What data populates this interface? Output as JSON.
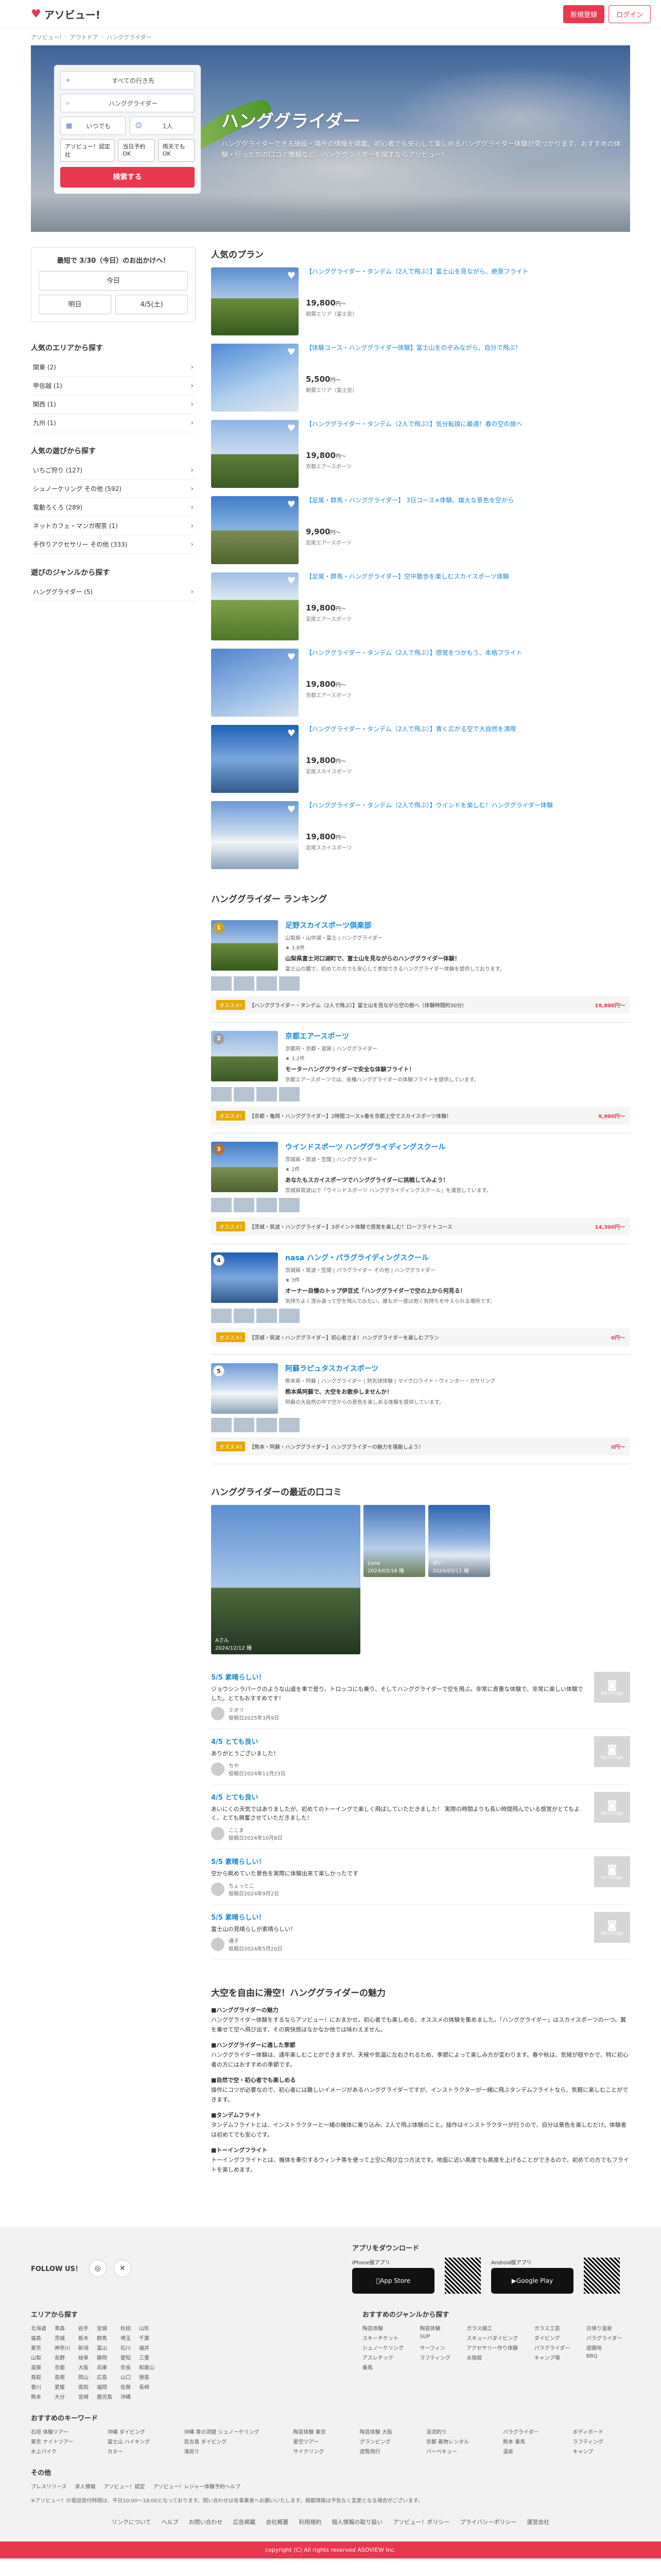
{
  "header": {
    "logo": "アソビュー!",
    "signup": "新規登録",
    "login": "ログイン"
  },
  "breadcrumb": [
    "アソビュー!",
    "アウトドア",
    "ハンググライダー"
  ],
  "search": {
    "area": "すべての行き先",
    "keyword": "ハンググライダー",
    "date": "いつでも",
    "people": "1人",
    "chip1": "アソビュー！認定社",
    "chip2": "当日予約OK",
    "chip3": "雨天でもOK",
    "button": "検索する"
  },
  "hero": {
    "title": "ハンググライダー",
    "desc": "ハンググライダーできる施設・場所の情報を掲載。初心者でも安心して楽しめるハンググライダー体験が見つかります。おすすめの体験・行った方の口コミ情報など、ハンググライダーを探すならアソビュー！"
  },
  "date_box": {
    "title": "最短で 3/30（今日）のお出かけへ！",
    "today": "今日",
    "tomorrow": "明日",
    "after": "4/5(土)"
  },
  "area_section": {
    "title": "人気のエリアから探す",
    "items": [
      "関東 (2)",
      "甲信越 (1)",
      "関西 (1)",
      "九州 (1)"
    ]
  },
  "play_section": {
    "title": "人気の遊びから探す",
    "items": [
      "いちご狩り (127)",
      "シュノーケリング その他 (592)",
      "電動ろくろ (289)",
      "ネットカフェ・マンガ喫茶 (1)",
      "手作りアクセサリー その他 (333)"
    ]
  },
  "genre_section": {
    "title": "遊びのジャンルから探す",
    "items": [
      "ハンググライダー (5)"
    ]
  },
  "plans_title": "人気のプラン",
  "plans": [
    {
      "title": "【ハンググライダー・タンデム（2人で飛ぶ）】富士山を見ながら、絶景フライト",
      "price": "19,800",
      "unit": "円〜",
      "shop": "朝霧エリア（富士宮）",
      "img": "img-a"
    },
    {
      "title": "【体験コース・ハンググライダー体験】富士山をのぞみながら、自分で飛ぶ！",
      "price": "5,500",
      "unit": "円〜",
      "shop": "朝霧エリア（富士宮）",
      "img": "img-b"
    },
    {
      "title": "【ハンググライダー・タンデム（2人で飛ぶ）】気分転換に最適！春の空の旅へ",
      "price": "19,800",
      "unit": "円〜",
      "shop": "京都エアースポーツ",
      "img": "img-c"
    },
    {
      "title": "【足尾・群馬・ハンググライダー】 3日コース×体験、雄大な景色を空から",
      "price": "9,900",
      "unit": "円〜",
      "shop": "足尾エアースポーツ",
      "img": "img-d"
    },
    {
      "title": "【足尾・群馬・ハンググライダー】空中散歩を楽しむスカイスポーツ体験",
      "price": "19,800",
      "unit": "円〜",
      "shop": "足尾エアースポーツ",
      "img": "img-e"
    },
    {
      "title": "【ハンググライダー・タンデム（2人で飛ぶ）】感覚をつかもう、本格フライト",
      "price": "19,800",
      "unit": "円〜",
      "shop": "京都エアースポーツ",
      "img": "img-f"
    },
    {
      "title": "【ハンググライダー・タンデム（2人で飛ぶ）】青く広がる空で大自然を満喫",
      "price": "19,800",
      "unit": "円〜",
      "shop": "足尾スカイスポーツ",
      "img": "img-g"
    },
    {
      "title": "【ハンググライダー・タンデム（2人で飛ぶ）】ウインドを楽しむ！ハンググライダー体験",
      "price": "19,800",
      "unit": "円〜",
      "shop": "足尾スカイスポーツ",
      "img": "img-h"
    }
  ],
  "ranking_title": "ハンググライダー ランキング",
  "ranking": [
    {
      "rank": "1",
      "name": "足野スカイスポーツ倶楽部",
      "meta": "山梨県・山中湖・富士 | ハンググライダー",
      "rating": "★ 3.8件",
      "lead": "山梨県富士河口湖町で、富士山を見ながらのハンググライダー体験！",
      "desc": "富士山の麓で、初めての方でも安心して参加できるハンググライダー体験を提供しております。",
      "plan": "【ハンググライダー・タンデム（2人で飛ぶ）】富士山を見ながら空の旅へ（体験時間約30分）",
      "price": "19,800円〜",
      "img": "img-a"
    },
    {
      "rank": "2",
      "name": "京都エアースポーツ",
      "meta": "京都府・京都・滋賀 | ハンググライダー",
      "rating": "★ 3.2件",
      "lead": "モーターハンググライダーで安全な体験フライト！",
      "desc": "京都エアースポーツでは、各種ハンググライダーの体験フライトを提供しています。",
      "plan": "【京都・亀岡・ハンググライダー】2時間コース×春を京都上空でスカイスポーツ体験！",
      "price": "9,900円〜",
      "img": "img-c"
    },
    {
      "rank": "3",
      "name": "ウインドスポーツ ハンググライディングスクール",
      "meta": "茨城県・筑波・笠間 | ハンググライダー",
      "rating": "★ 2件",
      "lead": "あなたもスカイスポーツでハンググライダーに挑戦してみよう！",
      "desc": "茨城県筑波山で「ウインドスポーツ ハンググライディングスクール」を運営しています。",
      "plan": "【茨城・筑波・ハンググライダー】3ポイント体験で感覚を楽しむ！ローフライトコース",
      "price": "14,300円〜",
      "img": "img-d"
    },
    {
      "rank": "4",
      "name": "nasa ハング・パラグライディングスクール",
      "meta": "茨城県・筑波・笠間 | パラグライダー その他 | ハンググライダー",
      "rating": "★ 3件",
      "lead": "オーナー自慢のトップ伊豆式「ハンググライダーで空の上から何見る！",
      "desc": "気持ちよく澄み渡って空を飛んでみたい。誰もが一度は抱く気持ちを叶えられる場所です。",
      "plan": "【茨城・筑波・ハンググライダー】初心者さま！ハンググライダーを楽しむプラン",
      "price": "0円〜",
      "img": "img-g"
    },
    {
      "rank": "5",
      "name": "阿蘇ラピュタスカイスポーツ",
      "meta": "熊本県・阿蘇 | ハンググライダー | 熱気球体験 | マイクロライト・ウィンター・ガサリング",
      "rating": "",
      "lead": "熊本県阿蘇で、大空をお散歩しませんか！",
      "desc": "阿蘇の大自然の中で空からの景色を楽しめる体験を提供しています。",
      "plan": "【熊本・阿蘇・ハンググライダー】ハンググライダーの魅力を堪能しよう！",
      "price": "0円〜",
      "img": "img-h"
    }
  ],
  "reviews_title": "ハンググライダーの最近の口コミ",
  "gallery": {
    "big": "Aさん\n2024/12/12 撮",
    "s1": "Luna\n2024/03/18 撮",
    "s2": "ゆい\n2024/03/11 撮"
  },
  "reviews": [
    {
      "title": "5/5 素晴らしい！",
      "body": "ジョウシンラパークのような山道を車で登り、トロッコにも乗り、そしてハンググライダーで空を飛ぶ。非常に貴重な体験で、非常に楽しい体験でした。とてもおすすめです！",
      "user": "ミオリ",
      "date": "投稿日2025年3月9日"
    },
    {
      "title": "4/5 とても良い",
      "body": "ありがとうございました！",
      "user": "ちや",
      "date": "投稿日2024年11月23日"
    },
    {
      "title": "4/5 とても良い",
      "body": "あいにくの天気ではありましたが、初めてのトーイングで楽しく飛ばしていただきました！ 実際の時間よりも長い時間飛んでいる感覚がとてもよく、とても興奮させていただきました！",
      "user": "ここま",
      "date": "投稿日2024年10月8日"
    },
    {
      "title": "5/5 素晴らしい！",
      "body": "空から眺めていた景色を実際に体験出来て楽しかったです",
      "user": "ちょっとこ",
      "date": "投稿日2024年9月2日"
    },
    {
      "title": "5/5 素晴らしい！",
      "body": "富士山の見晴らしが素晴らしい！",
      "user": "通子",
      "date": "投稿日2024年5月20日"
    }
  ],
  "noimg_label": "No Image",
  "charm": {
    "title": "大空を自由に滑空！ハンググライダーの魅力",
    "p1h": "■ハンググライダーの魅力",
    "p1": "ハンググライダー体験をするならアソビュー！におまかせ。初心者でも楽しめる、オススメの体験を集めました。「ハンググライダー」はスカイスポーツの一つ。翼を乗せて空へ飛び出す、その爽快感はなかなか他では味わえません。",
    "p2h": "■ハンググライダーに適した季節",
    "p2": "ハンググライダー体験は、通年楽しむことができますが、天候や気温に左右されるため、季節によって楽しみ方が変わります。春や秋は、気候が穏やかで、特に初心者の方にはおすすめの季節です。",
    "p3h": "■自然で空・初心者でも楽しめる",
    "p3": "操作にコツが必要なので、初心者には難しいイメージがあるハンググライダーですが、インストラクターが一緒に飛ぶタンデムフライトなら、気軽に楽しむことができます。",
    "p4h": "■タンデムフライト",
    "p4": "タンデムフライトとは、インストラクターと一緒の機体に乗り込み、2人で飛ぶ体験のこと。操作はインストラクターが行うので、自分は景色を楽しむだけ。体験者は初めてでも安心です。",
    "p5h": "■トーイングフライト",
    "p5": "トーイングフライトとは、機体を牽引するウィンチ等を使って上空に飛び立つ方法です。地面に近い高度でも高度を上げることができるので、初めての方でもフライトを楽しめます。"
  },
  "footer": {
    "follow": "FOLLOW US！",
    "download": "アプリをダウンロード",
    "iphone": "iPhone版アプリ",
    "android": "Android版アプリ",
    "appstore": "App Store",
    "googleplay": "Google Play",
    "area_title": "エリアから探す",
    "areas": [
      "北海道",
      "青森",
      "岩手",
      "宮城",
      "秋田",
      "山形",
      "福島",
      "茨城",
      "栃木",
      "群馬",
      "埼玉",
      "千葉",
      "東京",
      "神奈川",
      "新潟",
      "富山",
      "石川",
      "福井",
      "山梨",
      "長野",
      "岐阜",
      "静岡",
      "愛知",
      "三重",
      "滋賀",
      "京都",
      "大阪",
      "兵庫",
      "奈良",
      "和歌山",
      "鳥取",
      "島根",
      "岡山",
      "広島",
      "山口",
      "徳島",
      "香川",
      "愛媛",
      "高知",
      "福岡",
      "佐賀",
      "長崎",
      "熊本",
      "大分",
      "宮崎",
      "鹿児島",
      "沖縄"
    ],
    "genre_title": "おすすめのジャンルから探す",
    "genres": [
      "陶芸体験",
      "陶芸体験",
      "ガラス細工",
      "ガラス工芸",
      "日帰り温泉",
      "スキーチケット",
      "SUP",
      "スキューバダイビング",
      "ダイビング",
      "パラグライダー",
      "シュノーケリング",
      "サーフィン",
      "アクセサリー作り体験",
      "パラグライダー",
      "遊園地",
      "アスレチック",
      "ラフティング",
      "水族館",
      "キャンプ場",
      "BBQ",
      "乗馬"
    ],
    "kw_title": "おすすめのキーワード",
    "keywords": [
      "石垣 体験ツアー",
      "沖縄 ダイビング",
      "沖縄 青の洞窟 シュノーケリング",
      "陶芸体験 東京",
      "陶芸体験 大阪",
      "渓流釣り",
      "パラグライダー",
      "ボディボード",
      "東京 ナイトツアー",
      "富士山 ハイキング",
      "宮古島 ダイビング",
      "星空ツアー",
      "グランピング",
      "京都 着物レンタル",
      "熊本 乗馬",
      "ラフティング",
      "水上バイク",
      "カヌー",
      "滝巡り",
      "サイクリング",
      "遊覧飛行",
      "バーベキュー",
      "温泉",
      "キャンプ"
    ],
    "other_title": "その他",
    "other_items": [
      "プレスリリース",
      "求人情報",
      "アソビュー！認定",
      "アソビュー！レジャー体験予約ヘルプ"
    ],
    "note": "※アソビュー！の電話受付時間は、平日10:00〜18:00となっております。問い合わせは各事業者へお願いいたします。掲載情報は予告なく変更となる場合がございます。",
    "links": [
      "リンクについて",
      "ヘルプ",
      "お問い合わせ",
      "広告掲載",
      "会社概要",
      "利用規約",
      "個人情報の取り扱い",
      "アソビュー！ポリシー",
      "プライバシーポリシー",
      "運営会社"
    ],
    "copyright": "copyright (C) All rights reserved ASOVIEW Inc."
  }
}
